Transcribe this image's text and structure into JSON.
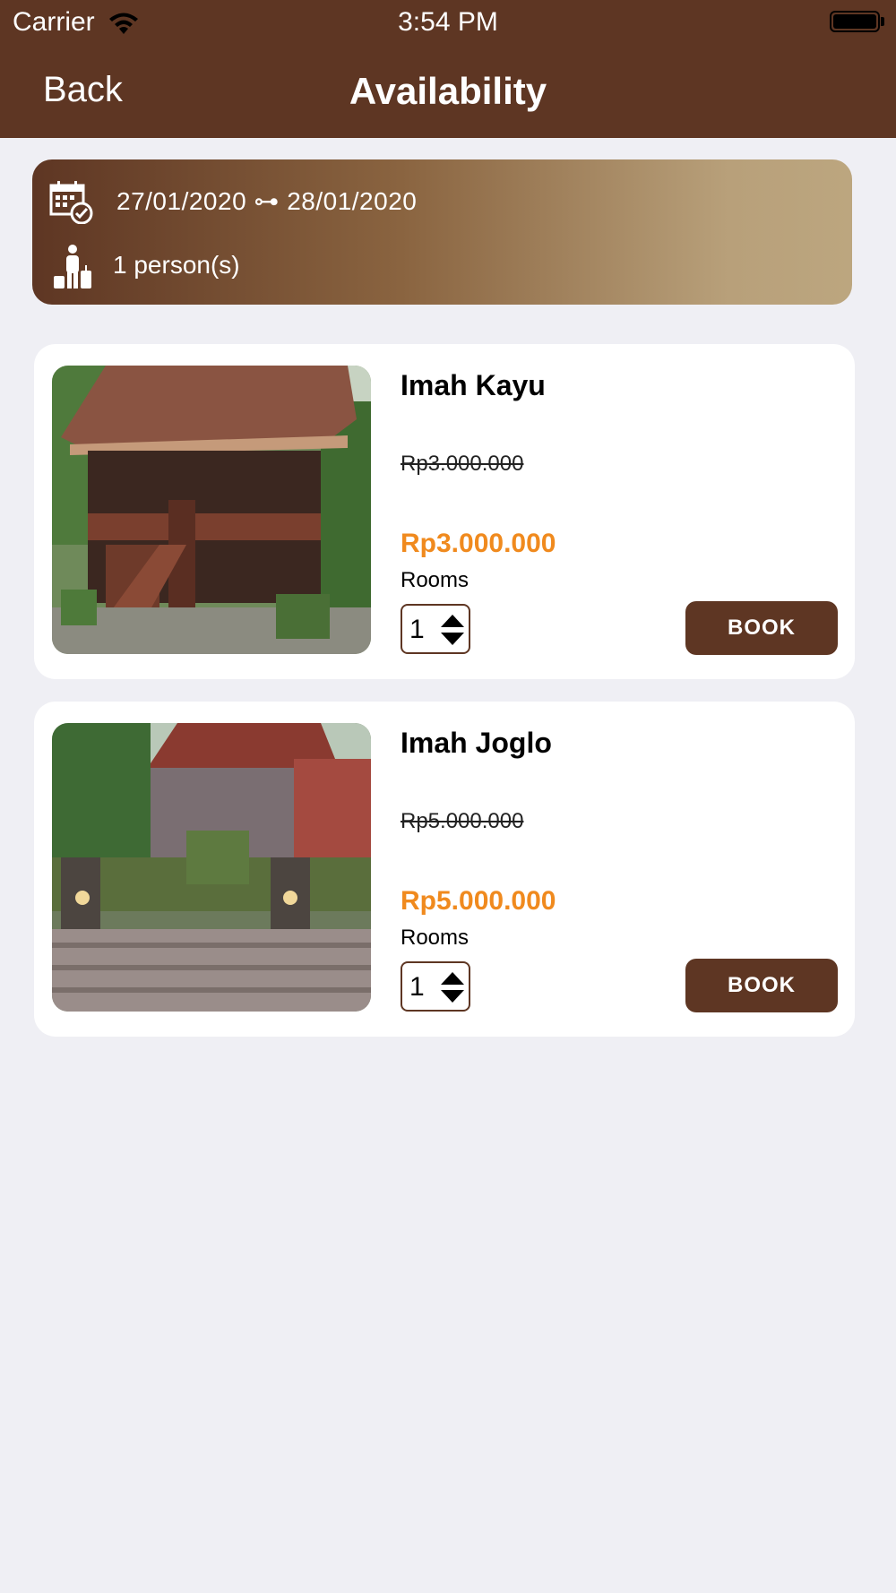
{
  "status_bar": {
    "carrier": "Carrier",
    "time": "3:54 PM"
  },
  "nav": {
    "back_label": "Back",
    "title": "Availability"
  },
  "summary": {
    "date_range": "27/01/2020 ⊶ 28/01/2020",
    "persons": "1 person(s)",
    "calendar_icon": "calendar-check-icon",
    "person_icon": "traveler-luggage-icon"
  },
  "rooms": [
    {
      "name": "Imah Kayu",
      "original_price": "Rp3.000.000",
      "price": "Rp3.000.000",
      "rooms_label": "Rooms",
      "quantity": "1",
      "book_label": "BOOK"
    },
    {
      "name": "Imah Joglo",
      "original_price": "Rp5.000.000",
      "price": "Rp5.000.000",
      "rooms_label": "Rooms",
      "quantity": "1",
      "book_label": "BOOK"
    }
  ],
  "colors": {
    "primary": "#5e3623",
    "price_accent": "#f08a1e",
    "background": "#efeff4"
  }
}
